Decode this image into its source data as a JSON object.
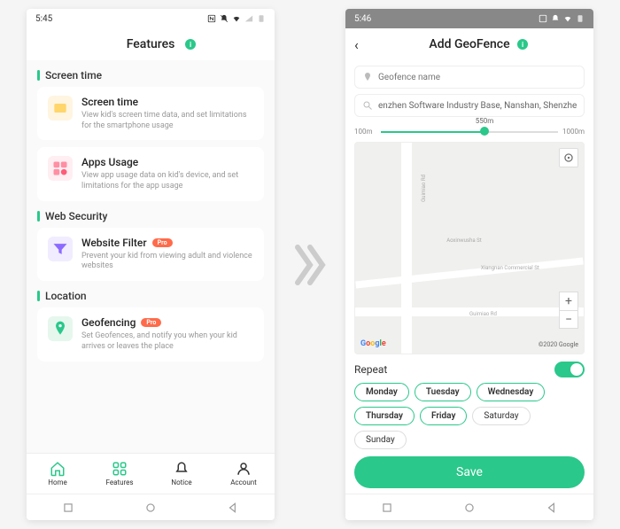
{
  "left": {
    "time": "5:45",
    "title": "Features",
    "sections": [
      {
        "title": "Screen time",
        "cards": [
          {
            "title": "Screen time",
            "desc": "View kid's screen time data, and set limitations for the smartphone usage",
            "icon_bg": "#ffd66b"
          },
          {
            "title": "Apps Usage",
            "desc": "View app usage data on kid's device, and set limitations for the app usage",
            "icon_bg": "#ffb3c0"
          }
        ]
      },
      {
        "title": "Web Security",
        "cards": [
          {
            "title": "Website Filter",
            "pro": "Pro",
            "desc": "Prevent your kid from viewing adult and violence websites",
            "icon_bg": "#9b7bff"
          }
        ]
      },
      {
        "title": "Location",
        "cards": [
          {
            "title": "Geofencing",
            "pro": "Pro",
            "desc": "Set Geofences, and notify you when your kid arrives or leaves the place",
            "icon_bg": "#b9e8d3"
          }
        ]
      }
    ],
    "nav": [
      "Home",
      "Features",
      "Notice",
      "Account"
    ]
  },
  "right": {
    "time": "5:46",
    "title": "Add GeoFence",
    "name_placeholder": "Geofence name",
    "address": "enzhen Software Industry Base, Nanshan, Shenzhen, Guangdong",
    "slider": {
      "min": "100m",
      "max": "1000m",
      "value": "550m"
    },
    "map": {
      "brand": "Google",
      "copyright": "©2020 Google",
      "road1": "Guimiao Rd",
      "road2": "Xiangnan Commercial St",
      "road3": "Guimiao Rd",
      "road4": "Aoxinwusha St"
    },
    "repeat_label": "Repeat",
    "days": [
      {
        "label": "Monday",
        "on": true
      },
      {
        "label": "Tuesday",
        "on": true
      },
      {
        "label": "Wednesday",
        "on": true
      },
      {
        "label": "Thursday",
        "on": true
      },
      {
        "label": "Friday",
        "on": true
      },
      {
        "label": "Saturday",
        "on": false
      },
      {
        "label": "Sunday",
        "on": false
      }
    ],
    "save": "Save"
  }
}
